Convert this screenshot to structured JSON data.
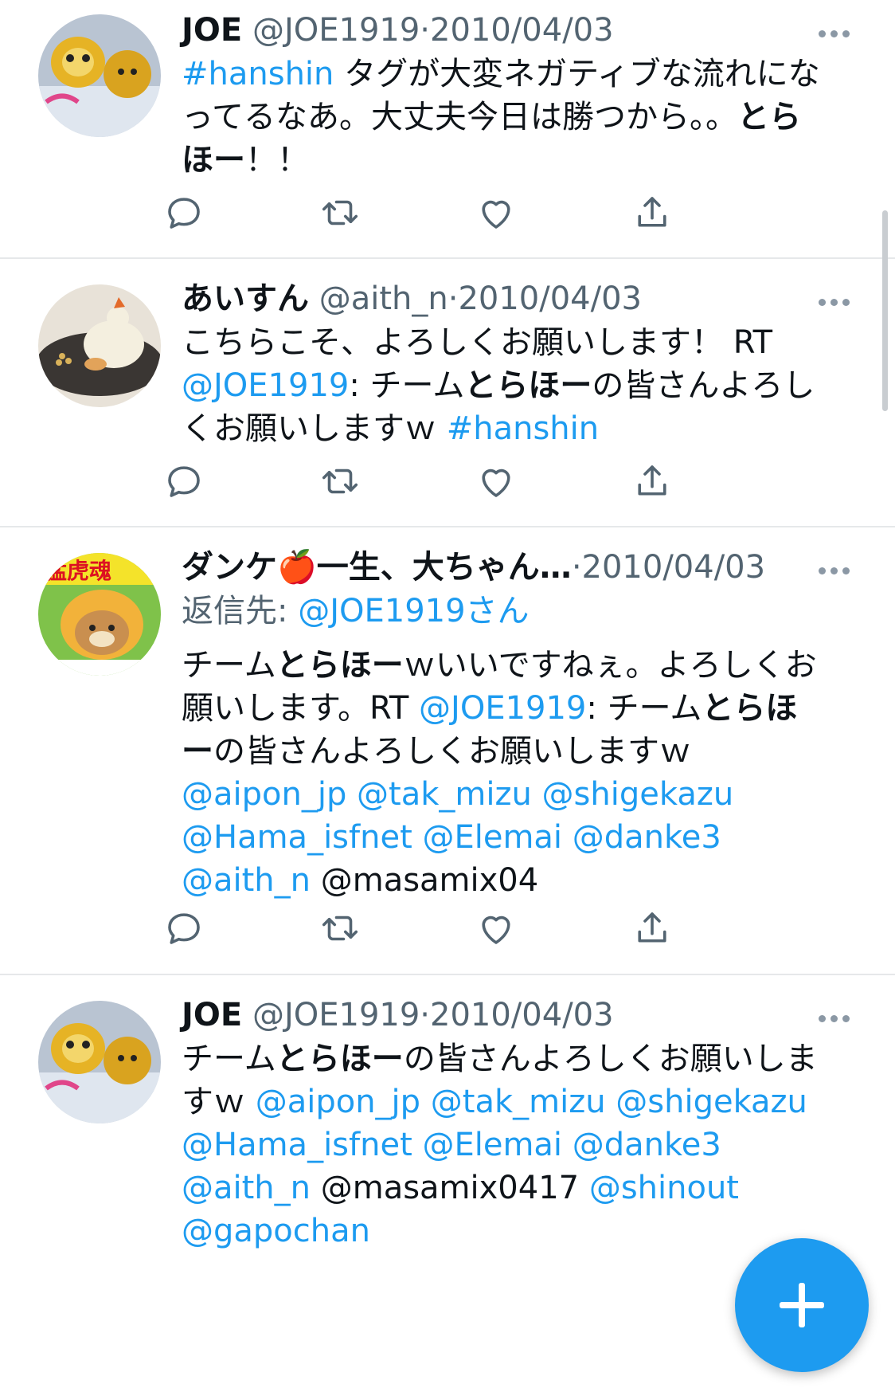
{
  "tweets": [
    {
      "name": "JOE",
      "handle": "@JOE1919",
      "sep": "·",
      "date": "2010/04/03",
      "lines": [
        [
          {
            "t": "#hanshin",
            "c": "link"
          },
          {
            "t": " タグが大変ネガティブな流れにな"
          }
        ],
        [
          {
            "t": "ってるなあ。大丈夫今日は勝つから。。"
          },
          {
            "t": "とら",
            "c": "b"
          }
        ],
        [
          {
            "t": "ほー",
            "c": "b"
          },
          {
            "t": "！！"
          }
        ]
      ]
    },
    {
      "name": "あいすん",
      "handle": "@aith_n",
      "sep": "·",
      "date": "2010/04/03",
      "lines": [
        [
          {
            "t": "こちらこそ、よろしくお願いします！ RT"
          }
        ],
        [
          {
            "t": "@JOE1919",
            "c": "link"
          },
          {
            "t": ": チーム"
          },
          {
            "t": "とらほー",
            "c": "b"
          },
          {
            "t": "の皆さんよろし"
          }
        ],
        [
          {
            "t": "くお願いしますｗ "
          },
          {
            "t": "#hanshin",
            "c": "link"
          }
        ]
      ]
    },
    {
      "name": "ダンケ🍎一生、大ちゃん…",
      "handle": "",
      "sep": "·",
      "date": "2010/04/03",
      "reply_prefix": "返信先: ",
      "reply_to": "@JOE1919さん",
      "lines": [
        [
          {
            "t": "チーム"
          },
          {
            "t": "とらほー",
            "c": "b"
          },
          {
            "t": "ｗいいですねぇ。よろしくお"
          }
        ],
        [
          {
            "t": "願いします。RT "
          },
          {
            "t": "@JOE1919",
            "c": "link"
          },
          {
            "t": ": チーム"
          },
          {
            "t": "とらほ",
            "c": "b"
          }
        ],
        [
          {
            "t": "ー",
            "c": "b"
          },
          {
            "t": "の皆さんよろしくお願いしますｗ"
          }
        ],
        [
          {
            "t": "@aipon_jp @tak_mizu @shigekazu",
            "c": "link"
          }
        ],
        [
          {
            "t": "@Hama_isfnet @Elemai @danke3",
            "c": "link"
          }
        ],
        [
          {
            "t": "@aith_n",
            "c": "link"
          },
          {
            "t": " @masamix04"
          }
        ]
      ]
    },
    {
      "name": "JOE",
      "handle": "@JOE1919",
      "sep": "·",
      "date": "2010/04/03",
      "lines": [
        [
          {
            "t": "チーム"
          },
          {
            "t": "とらほー",
            "c": "b"
          },
          {
            "t": "の皆さんよろしくお願いしま"
          }
        ],
        [
          {
            "t": "すｗ "
          },
          {
            "t": "@aipon_jp @tak_mizu @shigekazu",
            "c": "link"
          }
        ],
        [
          {
            "t": "@Hama_isfnet @Elemai @danke3",
            "c": "link"
          }
        ],
        [
          {
            "t": "@aith_n",
            "c": "link"
          },
          {
            "t": " @masamix0417 "
          },
          {
            "t": "@shinout",
            "c": "link"
          }
        ],
        [
          {
            "t": "@gapochan",
            "c": "link"
          }
        ]
      ]
    }
  ],
  "icons": {
    "reply": "reply-icon",
    "retweet": "retweet-icon",
    "like": "heart-icon",
    "share": "share-icon",
    "more": "more-icon",
    "compose": "compose-plus-icon"
  },
  "colors": {
    "link": "#1d9bf0",
    "muted": "#536471",
    "text": "#0f1419",
    "fab": "#1d9bf0"
  }
}
